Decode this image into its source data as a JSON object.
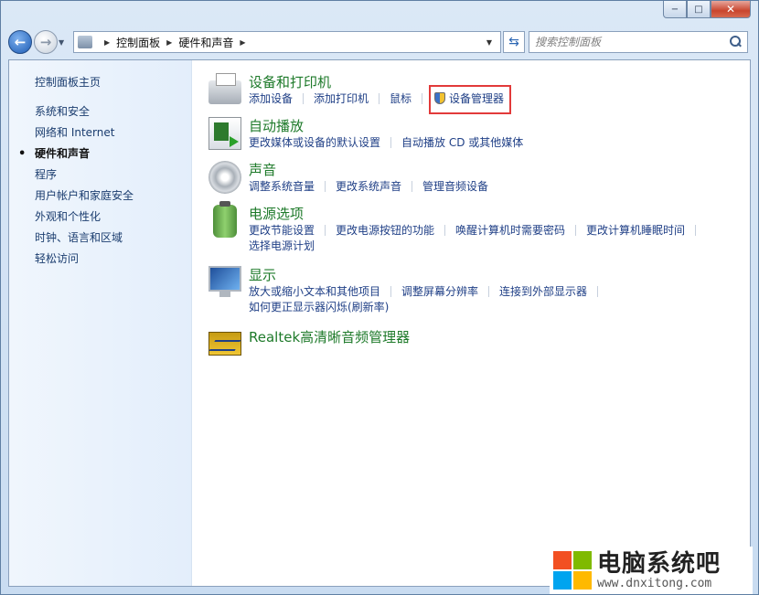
{
  "window": {
    "minimize_glyph": "−",
    "maximize_glyph": "□",
    "close_glyph": "✕"
  },
  "nav": {
    "back_glyph": "←",
    "forward_glyph": "→",
    "breadcrumbs": [
      "控制面板",
      "硬件和声音"
    ],
    "search_placeholder": "搜索控制面板"
  },
  "sidebar": {
    "items": [
      {
        "label": "控制面板主页"
      },
      {
        "label": "系统和安全"
      },
      {
        "label": "网络和 Internet"
      },
      {
        "label": "硬件和声音",
        "current": true
      },
      {
        "label": "程序"
      },
      {
        "label": "用户帐户和家庭安全"
      },
      {
        "label": "外观和个性化"
      },
      {
        "label": "时钟、语言和区域"
      },
      {
        "label": "轻松访问"
      }
    ]
  },
  "categories": [
    {
      "title": "设备和打印机",
      "icon": "printer-icon",
      "links": [
        "添加设备",
        "添加打印机",
        "鼠标",
        "设备管理器"
      ]
    },
    {
      "title": "自动播放",
      "icon": "autoplay-icon",
      "links": [
        "更改媒体或设备的默认设置",
        "自动播放 CD 或其他媒体"
      ]
    },
    {
      "title": "声音",
      "icon": "speaker-icon",
      "links": [
        "调整系统音量",
        "更改系统声音",
        "管理音频设备"
      ]
    },
    {
      "title": "电源选项",
      "icon": "battery-icon",
      "links": [
        "更改节能设置",
        "更改电源按钮的功能",
        "唤醒计算机时需要密码",
        "更改计算机睡眠时间",
        "选择电源计划"
      ]
    },
    {
      "title": "显示",
      "icon": "monitor-icon",
      "links": [
        "放大或缩小文本和其他项目",
        "调整屏幕分辨率",
        "连接到外部显示器",
        "如何更正显示器闪烁(刷新率)"
      ]
    },
    {
      "title": "Realtek高清晰音频管理器",
      "icon": "realtek-audio-icon",
      "links": []
    }
  ],
  "watermark": {
    "title": "电脑系统吧",
    "url": "www.dnxitong.com",
    "logo_colors": [
      "#f25022",
      "#7fba00",
      "#00a4ef",
      "#ffb900"
    ]
  },
  "colors": {
    "category_title": "#1e7a2a",
    "link": "#1f3f86",
    "highlight_box": "#e23a3a"
  }
}
